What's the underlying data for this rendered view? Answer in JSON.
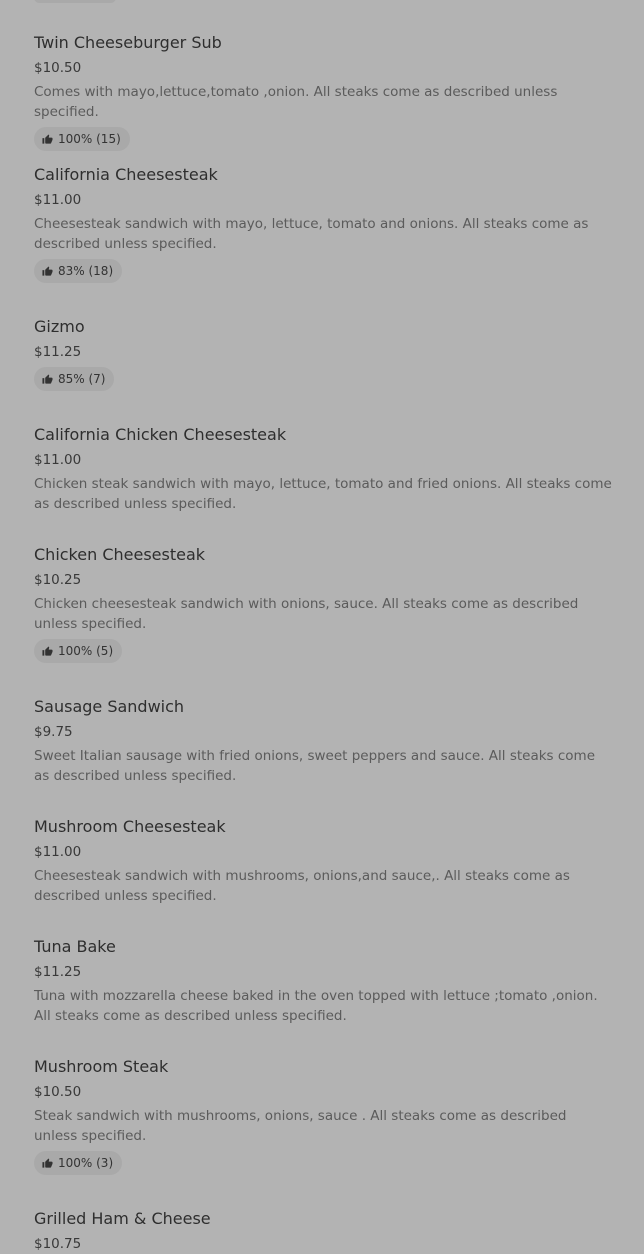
{
  "menu": {
    "items": [
      {
        "name": "Twin Cheeseburger Sub",
        "price": "$10.50",
        "description": "Comes with mayo,lettuce,tomato ,onion. All steaks come as described unless specified.",
        "rating": "100% (15)"
      },
      {
        "name": "California Cheesesteak",
        "price": "$11.00",
        "description": "Cheesesteak sandwich with mayo, lettuce, tomato and onions. All steaks come as described unless specified.",
        "rating": "83% (18)"
      },
      {
        "name": "Gizmo",
        "price": "$11.25",
        "rating": "85% (7)"
      },
      {
        "name": "California Chicken Cheesesteak",
        "price": "$11.00",
        "description": "Chicken steak sandwich with mayo, lettuce, tomato and fried onions. All steaks come as described unless specified."
      },
      {
        "name": "Chicken Cheesesteak",
        "price": "$10.25",
        "description": "Chicken cheesesteak sandwich with onions, sauce. All steaks come as described unless specified.",
        "rating": "100% (5)"
      },
      {
        "name": "Sausage Sandwich",
        "price": "$9.75",
        "description": "Sweet Italian sausage with fried onions, sweet peppers and sauce. All steaks come as described unless specified."
      },
      {
        "name": "Mushroom Cheesesteak",
        "price": "$11.00",
        "description": "Cheesesteak sandwich with mushrooms, onions,and sauce,. All steaks come as described unless specified."
      },
      {
        "name": "Tuna Bake",
        "price": "$11.25",
        "description": "Tuna with mozzarella cheese baked in the oven topped with lettuce ;tomato ,onion. All steaks come as described unless specified."
      },
      {
        "name": "Mushroom Steak",
        "price": "$10.50",
        "description": "Steak sandwich with mushrooms, onions, sauce . All steaks come as described unless specified.",
        "rating": "100% (3)"
      },
      {
        "name": "Grilled Ham & Cheese",
        "price": "$10.75"
      }
    ]
  }
}
